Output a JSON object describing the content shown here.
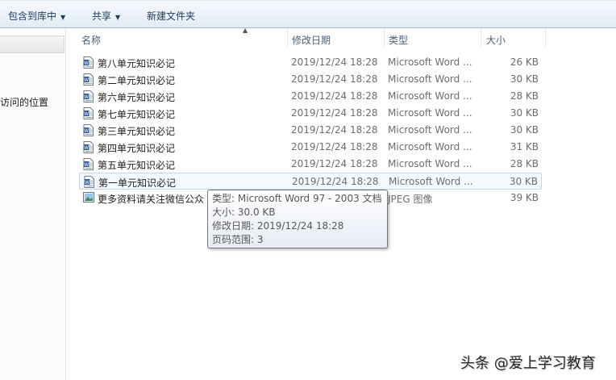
{
  "toolbar": {
    "include_library": "包含到库中",
    "share": "共享",
    "new_folder": "新建文件夹"
  },
  "sidebar": {
    "recent_places": "访问的位置"
  },
  "columns": {
    "name": "名称",
    "date": "修改日期",
    "type": "类型",
    "size": "大小"
  },
  "files": [
    {
      "name": "第八单元知识必记",
      "date": "2019/12/24 18:28",
      "type": "Microsoft Word ...",
      "size": "26 KB",
      "icon": "word-doc-icon"
    },
    {
      "name": "第二单元知识必记",
      "date": "2019/12/24 18:28",
      "type": "Microsoft Word ...",
      "size": "30 KB",
      "icon": "word-doc-icon"
    },
    {
      "name": "第六单元知识必记",
      "date": "2019/12/24 18:28",
      "type": "Microsoft Word ...",
      "size": "28 KB",
      "icon": "word-doc-icon"
    },
    {
      "name": "第七单元知识必记",
      "date": "2019/12/24 18:28",
      "type": "Microsoft Word ...",
      "size": "30 KB",
      "icon": "word-doc-icon"
    },
    {
      "name": "第三单元知识必记",
      "date": "2019/12/24 18:28",
      "type": "Microsoft Word ...",
      "size": "30 KB",
      "icon": "word-doc-icon"
    },
    {
      "name": "第四单元知识必记",
      "date": "2019/12/24 18:28",
      "type": "Microsoft Word ...",
      "size": "31 KB",
      "icon": "word-doc-icon"
    },
    {
      "name": "第五单元知识必记",
      "date": "2019/12/24 18:28",
      "type": "Microsoft Word ...",
      "size": "28 KB",
      "icon": "word-doc-icon"
    },
    {
      "name": "第一单元知识必记",
      "date": "2019/12/24 18:28",
      "type": "Microsoft Word ...",
      "size": "30 KB",
      "icon": "word-doc-icon"
    },
    {
      "name": "更多资料请关注微信公众",
      "date": "",
      "type": "JPEG 图像",
      "size": "39 KB",
      "icon": "image-file-icon"
    }
  ],
  "tooltip": {
    "type": "类型: Microsoft Word 97 - 2003 文档",
    "size": "大小: 30.0 KB",
    "modified": "修改日期: 2019/12/24 18:28",
    "pages": "页码范围: 3"
  },
  "watermark": "头条 @爱上学习教育"
}
